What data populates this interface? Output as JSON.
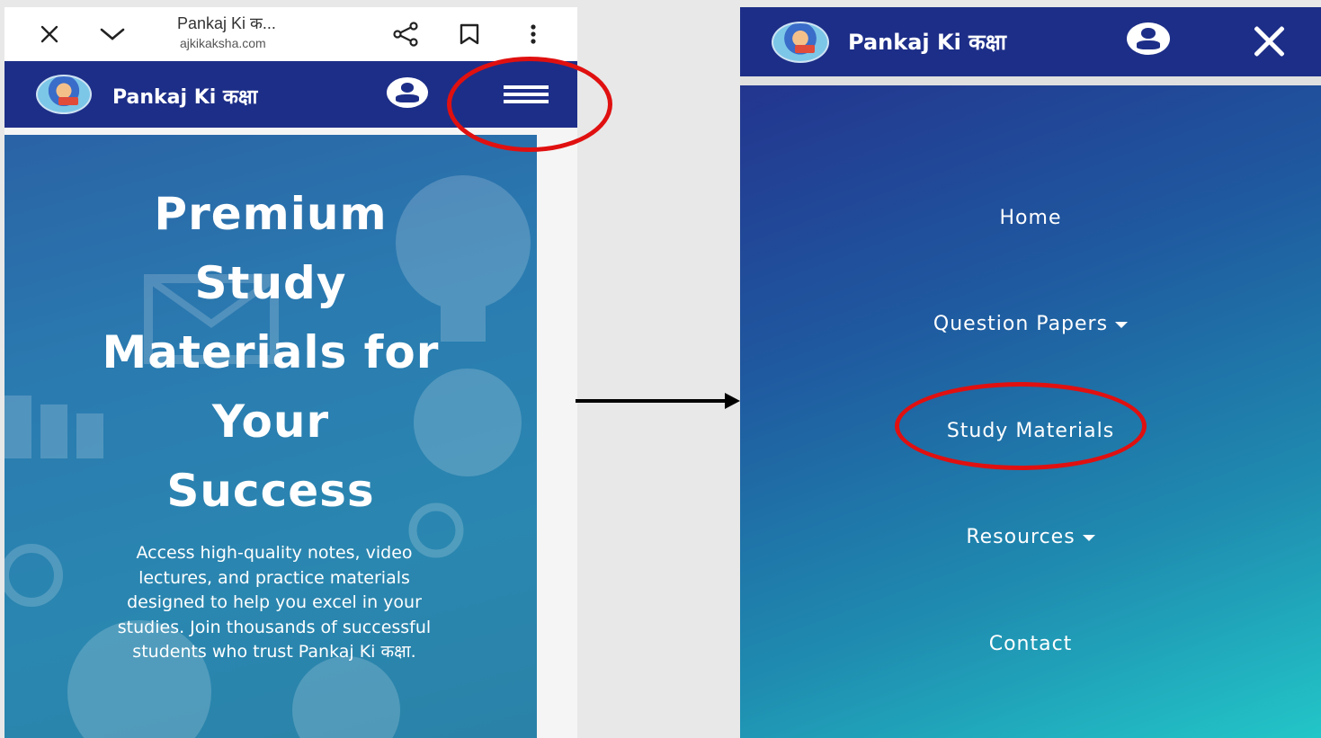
{
  "browser": {
    "tab_title": "Pankaj Ki क...",
    "url": "ajkikaksha.com"
  },
  "site": {
    "brand": "Pankaj Ki कक्षा"
  },
  "hero": {
    "title_lines": [
      "Premium",
      "Study",
      "Materials for",
      "Your",
      "Success"
    ],
    "description_lines": [
      "Access high-quality notes, video",
      "lectures, and practice materials",
      "designed to help you excel in your",
      "studies. Join thousands of successful",
      "students who trust Pankaj Ki कक्षा."
    ]
  },
  "menu": {
    "items": [
      {
        "label": "Home",
        "has_dropdown": false
      },
      {
        "label": "Question Papers",
        "has_dropdown": true
      },
      {
        "label": "Study Materials",
        "has_dropdown": false
      },
      {
        "label": "Resources",
        "has_dropdown": true
      },
      {
        "label": "Contact",
        "has_dropdown": false
      }
    ]
  },
  "colors": {
    "nav_bg": "#1d2e88",
    "highlight": "#e01010",
    "accent_teal": "#22c6c8"
  },
  "icons": [
    "close-icon",
    "chevron-down-icon",
    "share-icon",
    "bookmark-icon",
    "more-vert-icon",
    "user-icon",
    "hamburger-menu-icon"
  ]
}
